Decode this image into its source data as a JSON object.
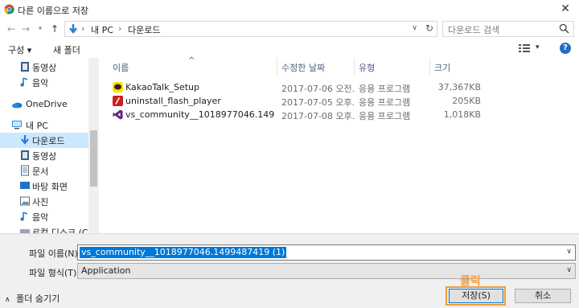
{
  "window": {
    "title": "다른 이름으로 저장",
    "close_glyph": "✕"
  },
  "address": {
    "crumbs": [
      "내 PC",
      "다운로드"
    ],
    "search_placeholder": "다운로드 검색"
  },
  "toolbar": {
    "organize": "구성 ▾",
    "new_folder": "새 폴더"
  },
  "nav": {
    "items": [
      {
        "label": "동영상",
        "icon": "video-icon"
      },
      {
        "label": "음악",
        "icon": "music-icon"
      },
      {
        "label": "OneDrive",
        "icon": "onedrive-icon"
      },
      {
        "label": "내 PC",
        "icon": "pc-icon"
      },
      {
        "label": "다운로드",
        "icon": "download-icon",
        "selected": true
      },
      {
        "label": "동영상",
        "icon": "video-icon"
      },
      {
        "label": "문서",
        "icon": "document-icon"
      },
      {
        "label": "바탕 화면",
        "icon": "desktop-icon"
      },
      {
        "label": "사진",
        "icon": "picture-icon"
      },
      {
        "label": "음악",
        "icon": "music-icon"
      },
      {
        "label": "로컬 디스크 (C:)",
        "icon": "disk-icon"
      }
    ]
  },
  "columns": {
    "name": "이름",
    "date": "수정한 날짜",
    "type": "유형",
    "size": "크기"
  },
  "files": [
    {
      "name": "KakaoTalk_Setup",
      "date": "2017-07-06 오전...",
      "type": "응용 프로그램",
      "size": "37,367KB",
      "icon": "kakaotalk-icon"
    },
    {
      "name": "uninstall_flash_player",
      "date": "2017-07-05 오후...",
      "type": "응용 프로그램",
      "size": "205KB",
      "icon": "flash-icon"
    },
    {
      "name": "vs_community__1018977046.14994874...",
      "date": "2017-07-08 오후...",
      "type": "응용 프로그램",
      "size": "1,018KB",
      "icon": "visual-studio-icon"
    }
  ],
  "form": {
    "filename_label": "파일 이름(N):",
    "filename_value": "vs_community__1018977046.1499487419 (1)",
    "filetype_label": "파일 형식(T):",
    "filetype_value": "Application",
    "hide_folders": "폴더 숨기기",
    "save": "저장(S)",
    "cancel": "취소",
    "click_annotation": "클릭"
  },
  "colors": {
    "selection": "#cce8ff",
    "highlight": "#f39c3b",
    "accent": "#0078d7"
  }
}
